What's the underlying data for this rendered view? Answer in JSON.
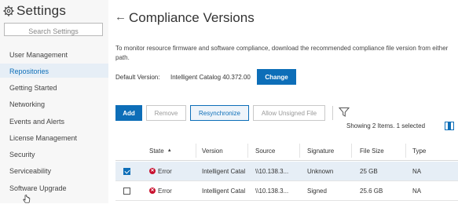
{
  "sidebar": {
    "title": "Settings",
    "search_placeholder": "Search Settings",
    "items": [
      {
        "label": "User Management"
      },
      {
        "label": "Repositories"
      },
      {
        "label": "Getting Started"
      },
      {
        "label": "Networking"
      },
      {
        "label": "Events and Alerts"
      },
      {
        "label": "License Management"
      },
      {
        "label": "Security"
      },
      {
        "label": "Serviceability"
      },
      {
        "label": "Software Upgrade"
      }
    ],
    "active": "Repositories"
  },
  "main": {
    "back_arrow": "←",
    "title": "Compliance Versions",
    "description": "To monitor resource firmware and software compliance, download the recommended compliance file version from either path.",
    "default_version_label": "Default Version:",
    "default_version_value": "Intelligent Catalog 40.372.00",
    "change_label": "Change"
  },
  "toolbar": {
    "add_label": "Add",
    "remove_label": "Remove",
    "resync_label": "Resynchronize",
    "allow_label": "Allow Unsigned File",
    "showing_text": "Showing 2 Items. 1 selected"
  },
  "table": {
    "headers": {
      "state": "State",
      "version": "Version",
      "source": "Source",
      "signature": "Signature",
      "file_size": "File Size",
      "type": "Type"
    },
    "sort_indicator": "▲",
    "rows": [
      {
        "selected": true,
        "state": "Error",
        "version": "Intelligent Catal",
        "source": "\\\\10.138.3...",
        "signature": "Unknown",
        "file_size": "25 GB",
        "type": "NA"
      },
      {
        "selected": false,
        "state": "Error",
        "version": "Intelligent Catal",
        "source": "\\\\10.138.3...",
        "signature": "Signed",
        "file_size": "25.6 GB",
        "type": "NA"
      }
    ]
  },
  "colors": {
    "accent": "#0d6eb8",
    "error": "#c8102e",
    "selected_row": "#e6eef6"
  }
}
